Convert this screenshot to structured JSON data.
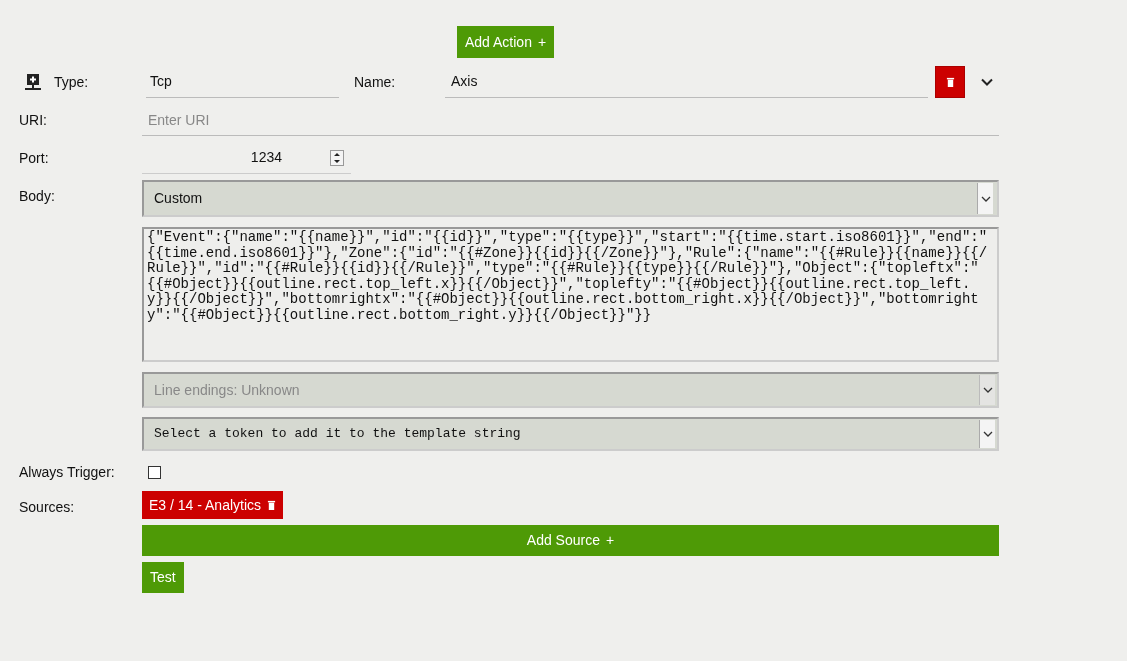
{
  "add_action_button": {
    "label": "Add Action",
    "icon": "+"
  },
  "action": {
    "type_label": "Type:",
    "type_value": "Tcp",
    "name_label": "Name:",
    "name_value": "Axis",
    "expanded": false
  },
  "uri": {
    "label": "URI:",
    "placeholder": "Enter URI"
  },
  "port": {
    "label": "Port:",
    "value": "1234"
  },
  "body": {
    "label": "Body:",
    "format": "Custom",
    "template": "{\"Event\":{\"name\":\"{{name}}\",\"id\":\"{{id}}\",\"type\":\"{{type}}\",\"start\":\"{{time.start.iso8601}}\",\"end\":\"{{time.end.iso8601}}\"},\"Zone\":{\"id\":\"{{#Zone}}{{id}}{{/Zone}}\"},\"Rule\":{\"name\":\"{{#Rule}}{{name}}{{/Rule}}\",\"id\":\"{{#Rule}}{{id}}{{/Rule}}\",\"type\":\"{{#Rule}}{{type}}{{/Rule}}\"},\"Object\":{\"topleftx\":\"{{#Object}}{{outline.rect.top_left.x}}{{/Object}}\",\"toplefty\":\"{{#Object}}{{outline.rect.top_left.y}}{{/Object}}\",\"bottomrightx\":\"{{#Object}}{{outline.rect.bottom_right.x}}{{/Object}}\",\"bottomrighty\":\"{{#Object}}{{outline.rect.bottom_right.y}}{{/Object}}\"}}",
    "line_endings": {
      "value": "Line endings: Unknown",
      "disabled": true
    },
    "token_select": "Select a token to add it to the template string"
  },
  "always_trigger": {
    "label": "Always Trigger:",
    "checked": false
  },
  "sources": {
    "label": "Sources:",
    "items": [
      {
        "label": "E3 / 14 - Analytics"
      }
    ],
    "add_label": "Add Source",
    "add_icon": "+"
  },
  "test_button": "Test"
}
